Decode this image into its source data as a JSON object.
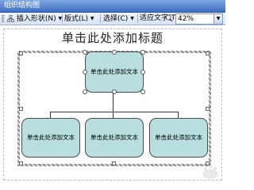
{
  "window": {
    "title": "组织结构图"
  },
  "toolbar": {
    "insert_shape_label": "插入形状(N)",
    "layout_label": "版式(L)",
    "select_label": "选择(C)",
    "fit_text_label": "适应文字(T)",
    "zoom_value": "42%"
  },
  "slide": {
    "title": "单击此处添加标题",
    "top_box": "单击此处添加文本",
    "children": [
      {
        "label": "单击此处添加文本"
      },
      {
        "label": "单击此处添加文本"
      },
      {
        "label": "单击此处添加文本"
      }
    ]
  },
  "colors": {
    "titlebar": "#3f6fc4",
    "box_fill": "#b9dede",
    "box_border": "#4a4a4a"
  }
}
